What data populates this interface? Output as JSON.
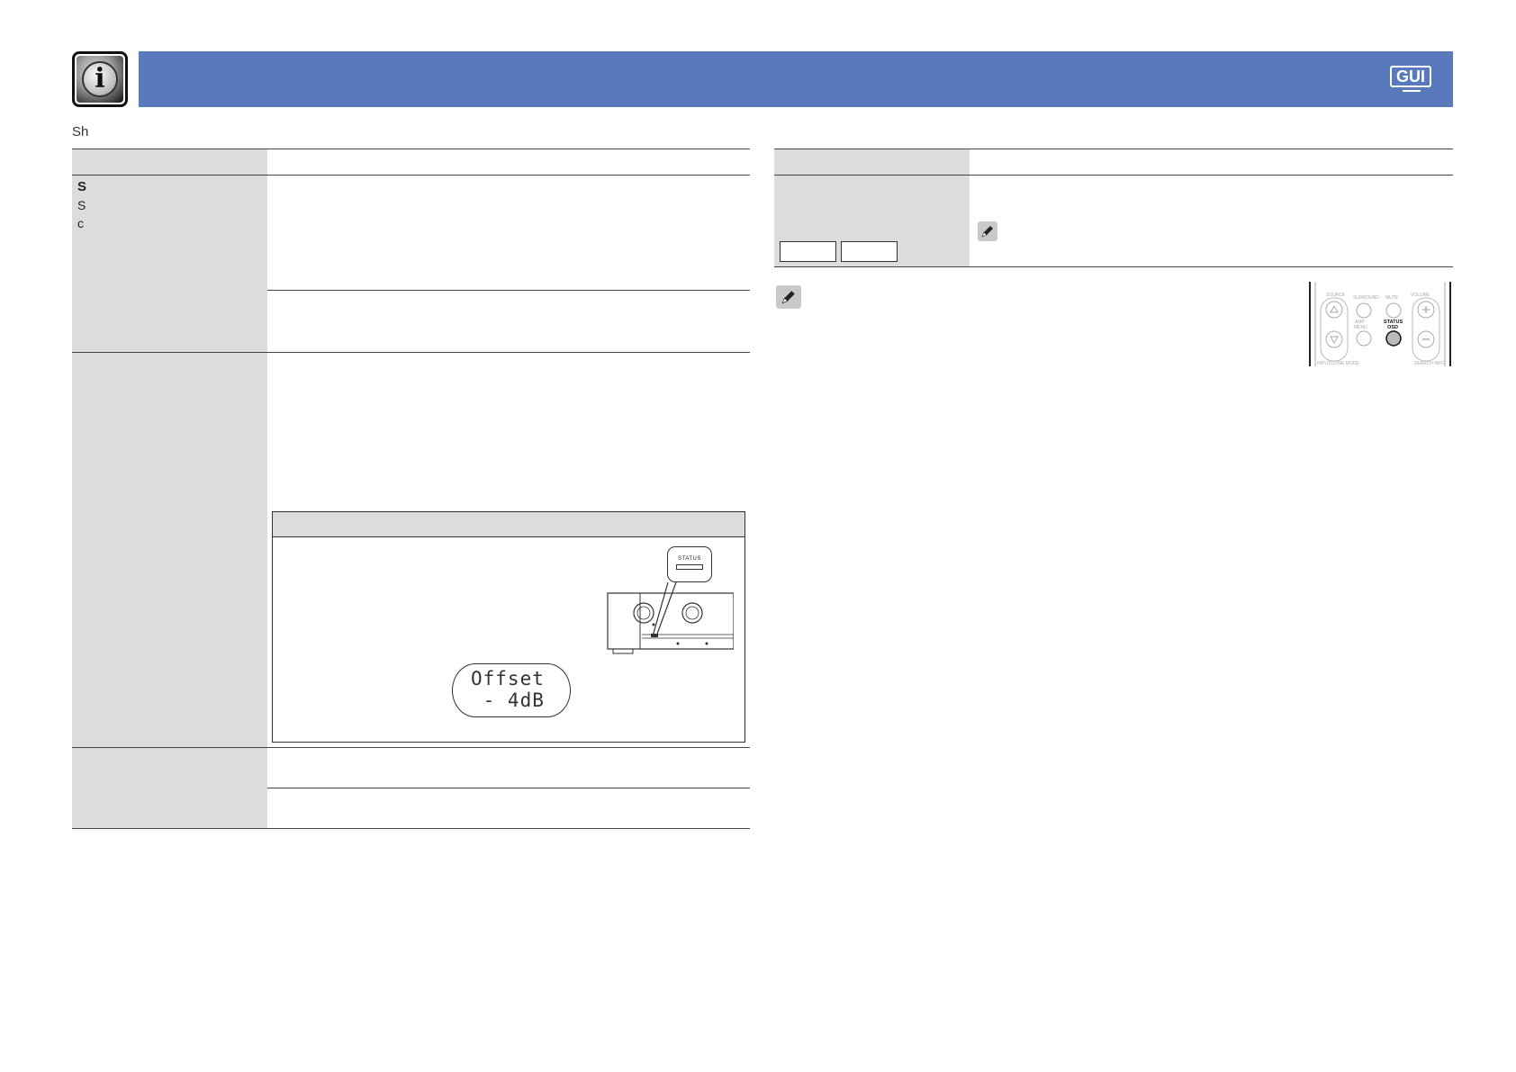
{
  "header": {
    "info_icon_glyph": "i",
    "gui_badge": "GUI",
    "bar_color": "#5879bb"
  },
  "page": {
    "sub_label": "Sh"
  },
  "left_table": {
    "s_letters": [
      "S",
      "S",
      "c"
    ]
  },
  "status_inset": {
    "button_label": "STATUS",
    "display_line1": "Offset",
    "display_line2": " - 4dB"
  },
  "remote": {
    "labels": [
      "SOURCE",
      "SURROUND",
      "MUTE",
      "VOLUME",
      "AMP MENU",
      "STATUS",
      "OSD",
      "INPUT/ZONE MODE",
      "SEARCH INFO"
    ]
  }
}
